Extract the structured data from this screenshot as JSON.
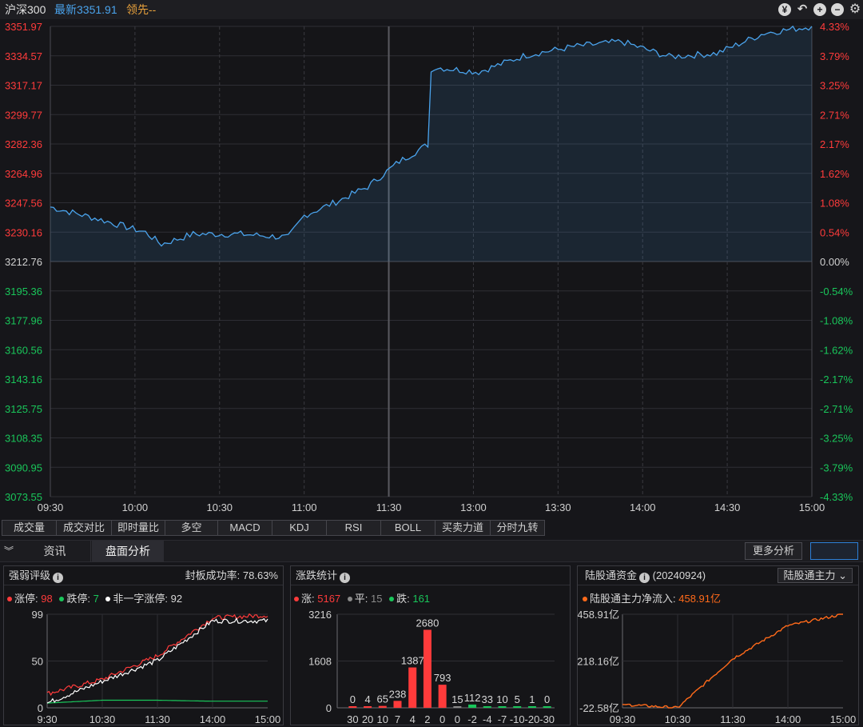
{
  "header": {
    "index_name": "沪深300",
    "latest": "最新3351.91",
    "leader": "领先--"
  },
  "colors": {
    "up": "#ff3b3b",
    "down": "#19c65a",
    "line": "#4aa3ec",
    "bg": "#16161a",
    "grid": "#2e2e34"
  },
  "main_chart": {
    "y_left": [
      "3351.97",
      "3334.57",
      "3317.17",
      "3299.77",
      "3282.36",
      "3264.96",
      "3247.56",
      "3230.16",
      "3212.76",
      "3195.36",
      "3177.96",
      "3160.56",
      "3143.16",
      "3125.75",
      "3108.35",
      "3090.95",
      "3073.55"
    ],
    "y_right": [
      "4.33%",
      "3.79%",
      "3.25%",
      "2.71%",
      "2.17%",
      "1.62%",
      "1.08%",
      "0.54%",
      "0.00%",
      "-0.54%",
      "-1.08%",
      "-1.62%",
      "-2.17%",
      "-2.71%",
      "-3.25%",
      "-3.79%",
      "-4.33%"
    ],
    "x_ticks": [
      "09:30",
      "10:00",
      "10:30",
      "11:00",
      "11:30",
      "13:00",
      "13:30",
      "14:00",
      "14:30",
      "15:00"
    ]
  },
  "chart_data": [
    {
      "type": "line",
      "x": [
        "09:30",
        "09:45",
        "10:00",
        "10:05",
        "10:15",
        "10:30",
        "10:45",
        "10:50",
        "11:00",
        "11:10",
        "11:20",
        "11:29",
        "11:30",
        "13:00",
        "13:15",
        "13:30",
        "13:45",
        "14:00",
        "14:15",
        "14:30",
        "14:45",
        "15:00"
      ],
      "values": [
        3245,
        3238,
        3230,
        3223,
        3229,
        3229,
        3227,
        3240,
        3248,
        3257,
        3272,
        3282,
        3325,
        3328,
        3325,
        3335,
        3340,
        3343,
        3334,
        3336,
        3348,
        3352
      ],
      "ylim": [
        3073.55,
        3351.97
      ]
    },
    {
      "type": "line",
      "title": "强弱评级",
      "x": [
        "9:30",
        "10:30",
        "11:30",
        "14:00",
        "15:00"
      ],
      "series": [
        {
          "name": "涨停",
          "values": [
            15,
            30,
            55,
            95,
            98
          ]
        },
        {
          "name": "跌停",
          "values": [
            5,
            8,
            8,
            7,
            7
          ]
        },
        {
          "name": "非一字涨停",
          "values": [
            5,
            28,
            50,
            92,
            92
          ]
        }
      ],
      "ylim": [
        0,
        99
      ]
    },
    {
      "type": "bar",
      "title": "涨跌统计",
      "categories": [
        "30",
        "20",
        "10",
        "7",
        "4",
        "2",
        "0",
        "0",
        "-2",
        "-4",
        "-7",
        "-10",
        "-20",
        "-30"
      ],
      "values": [
        0,
        4,
        65,
        238,
        1387,
        2680,
        793,
        15,
        112,
        33,
        10,
        5,
        1,
        0
      ],
      "ylim": [
        0,
        3216
      ]
    },
    {
      "type": "line",
      "title": "陆股通资金",
      "x": [
        "09:30",
        "10:30",
        "11:30",
        "14:00",
        "15:00"
      ],
      "values": [
        -5,
        -22.58,
        230,
        400,
        458.91
      ],
      "ylim": [
        -22.58,
        458.91
      ]
    }
  ],
  "tabs": [
    "成交量",
    "成交对比",
    "即时量比",
    "多空",
    "MACD",
    "KDJ",
    "RSI",
    "BOLL",
    "买卖力道",
    "分时九转"
  ],
  "subbar": {
    "news": "资讯",
    "analysis": "盘面分析",
    "more": "更多分析"
  },
  "panel1": {
    "title": "强弱评级",
    "rate_label": "封板成功率: 78.63%",
    "limit_up_label": "涨停: ",
    "limit_up": "98",
    "limit_down_label": "跌停: ",
    "limit_down": "7",
    "non_one_label": "非一字涨停: ",
    "non_one": "92",
    "y": [
      "99",
      "50",
      "0"
    ],
    "x": [
      "9:30",
      "10:30",
      "11:30",
      "14:00",
      "15:00"
    ]
  },
  "panel2": {
    "title": "涨跌统计",
    "up_label": "涨: ",
    "up": "5167",
    "flat_label": "平: ",
    "flat": "15",
    "down_label": "跌: ",
    "down": "161",
    "y": [
      "3216",
      "1608",
      "0"
    ]
  },
  "panel3": {
    "title": "陆股通资金",
    "date": "(20240924)",
    "select": "陆股通主力",
    "flow_label": "陆股通主力净流入: ",
    "flow": "458.91亿",
    "y": [
      "458.91亿",
      "218.16亿",
      "-22.58亿"
    ],
    "x": [
      "09:30",
      "10:30",
      "11:30",
      "14:00",
      "15:00"
    ]
  }
}
